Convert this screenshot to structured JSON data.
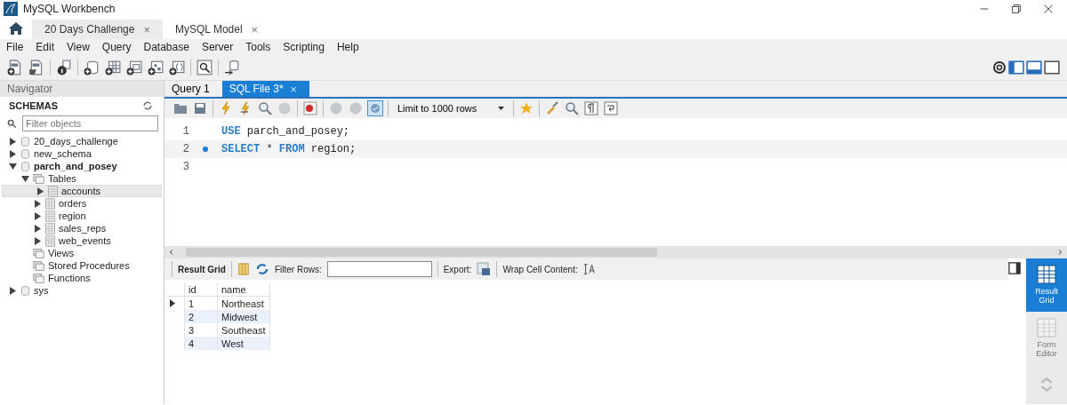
{
  "window": {
    "title": "MySQL Workbench"
  },
  "window_tabs": [
    {
      "label": "20 Days Challenge",
      "selected": true,
      "close": "×"
    },
    {
      "label": "MySQL Model",
      "selected": false,
      "close": "×"
    }
  ],
  "menu": [
    "File",
    "Edit",
    "View",
    "Query",
    "Database",
    "Server",
    "Tools",
    "Scripting",
    "Help"
  ],
  "navigator": {
    "title": "Navigator",
    "section": "SCHEMAS",
    "filter_placeholder": "Filter objects",
    "tree": [
      {
        "label": "20_days_challenge",
        "kind": "schema",
        "expanded": false,
        "default_schema": false,
        "selected": false
      },
      {
        "label": "new_schema",
        "kind": "schema",
        "expanded": false,
        "default_schema": false,
        "selected": false
      },
      {
        "label": "parch_and_posey",
        "kind": "schema",
        "expanded": true,
        "default_schema": true,
        "selected": false,
        "children": [
          {
            "label": "Tables",
            "kind": "folder",
            "expanded": true,
            "selected": false,
            "children": [
              {
                "label": "accounts",
                "kind": "table",
                "expanded": false,
                "selected": true
              },
              {
                "label": "orders",
                "kind": "table",
                "expanded": false,
                "selected": false
              },
              {
                "label": "region",
                "kind": "table",
                "expanded": false,
                "selected": false
              },
              {
                "label": "sales_reps",
                "kind": "table",
                "expanded": false,
                "selected": false
              },
              {
                "label": "web_events",
                "kind": "table",
                "expanded": false,
                "selected": false
              }
            ]
          },
          {
            "label": "Views",
            "kind": "folder",
            "selected": false
          },
          {
            "label": "Stored Procedures",
            "kind": "folder",
            "selected": false
          },
          {
            "label": "Functions",
            "kind": "folder",
            "selected": false
          }
        ]
      },
      {
        "label": "sys",
        "kind": "schema",
        "expanded": false,
        "default_schema": false,
        "selected": false
      }
    ]
  },
  "editor_tabs": [
    {
      "label": "Query 1",
      "selected": false
    },
    {
      "label": "SQL File 3*",
      "selected": true,
      "close": "×"
    }
  ],
  "limit": "Limit to 1000 rows",
  "code": [
    {
      "number": "1",
      "marker": false,
      "tokens": [
        {
          "kind": "keyword",
          "text": "USE"
        },
        {
          "kind": "plain",
          "text": " parch_and_posey;"
        }
      ]
    },
    {
      "number": "2",
      "marker": true,
      "tokens": [
        {
          "kind": "keyword",
          "text": "SELECT"
        },
        {
          "kind": "plain",
          "text": " * "
        },
        {
          "kind": "keyword",
          "text": "FROM"
        },
        {
          "kind": "plain",
          "text": " region;"
        }
      ]
    },
    {
      "number": "3",
      "marker": false
    }
  ],
  "results_toolbar": {
    "result_grid": "Result Grid",
    "filter": "Filter Rows:",
    "export": "Export:",
    "wrap": "Wrap Cell Content:"
  },
  "grid": {
    "columns": [
      "id",
      "name"
    ],
    "rows": [
      {
        "current": true,
        "cells": [
          "1",
          "Northeast"
        ]
      },
      {
        "current": false,
        "cells": [
          "2",
          "Midwest"
        ]
      },
      {
        "current": false,
        "cells": [
          "3",
          "Southeast"
        ]
      },
      {
        "current": false,
        "cells": [
          "4",
          "West"
        ]
      }
    ]
  },
  "side_panel": [
    {
      "label": "Result Grid",
      "selected": true
    },
    {
      "label": "Form Editor",
      "selected": false
    }
  ]
}
